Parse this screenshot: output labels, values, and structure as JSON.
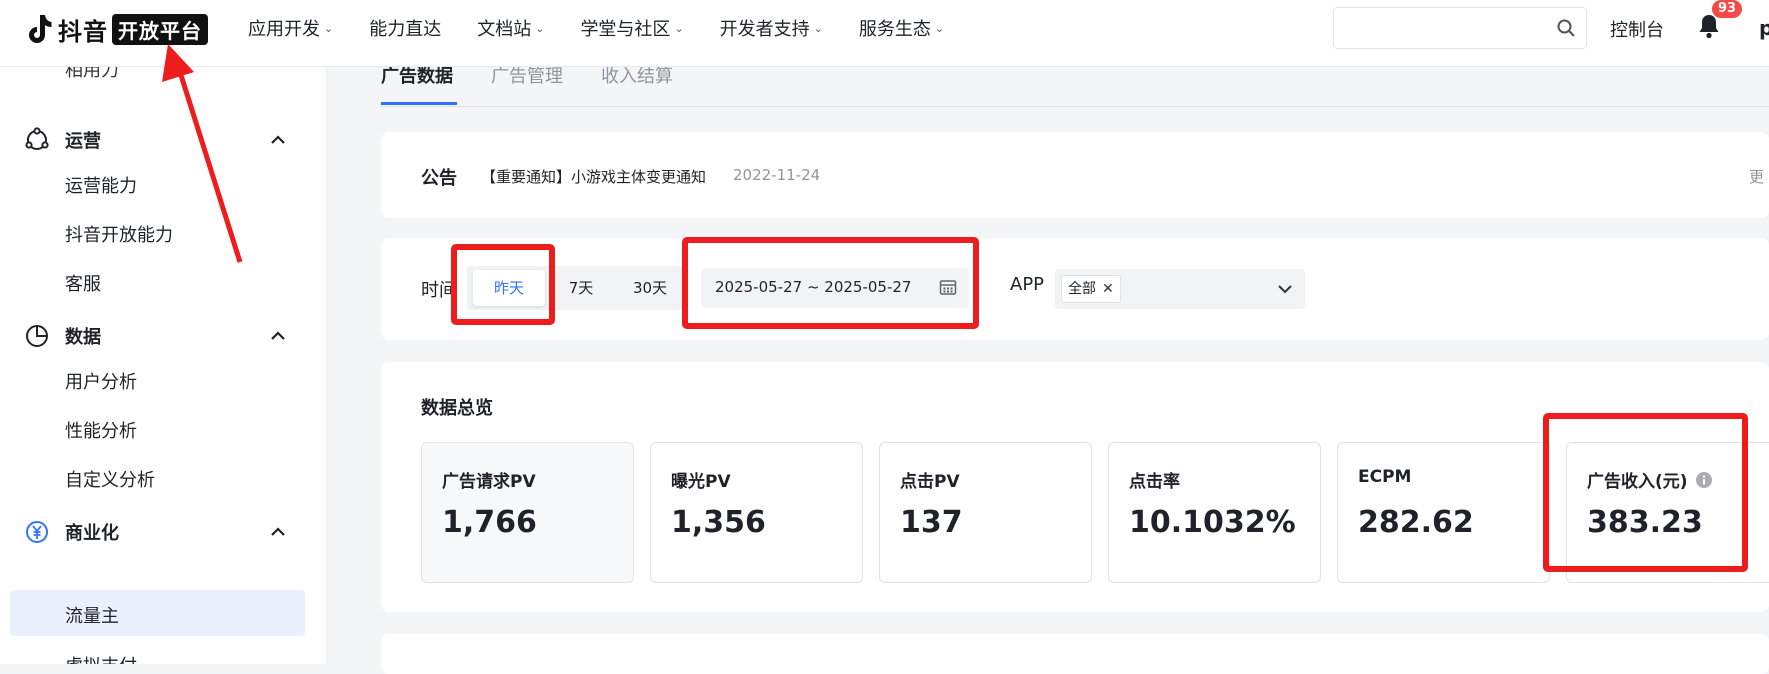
{
  "topnav": {
    "logo_text": "抖音",
    "logo_badge": "开放平台",
    "items": [
      {
        "label": "应用开发",
        "has_dropdown": true
      },
      {
        "label": "能力直达",
        "has_dropdown": false
      },
      {
        "label": "文档站",
        "has_dropdown": true
      },
      {
        "label": "学堂与社区",
        "has_dropdown": true
      },
      {
        "label": "开发者支持",
        "has_dropdown": true
      },
      {
        "label": "服务生态",
        "has_dropdown": true
      }
    ],
    "search": {
      "placeholder": "",
      "icon": "search-icon"
    },
    "console_label": "控制台",
    "notification_count": "93",
    "avatar_letter": "p"
  },
  "sidebar": {
    "partial_top_item": "相用力",
    "groups": [
      {
        "label": "运营",
        "icon": "operations-icon",
        "items": [
          "运营能力",
          "抖音开放能力",
          "客服"
        ]
      },
      {
        "label": "数据",
        "icon": "pie-chart-icon",
        "items": [
          "用户分析",
          "性能分析",
          "自定义分析"
        ]
      },
      {
        "label": "商业化",
        "icon": "yuan-icon",
        "items": [
          "流量主",
          "虚拟支付"
        ]
      }
    ],
    "active_item": "流量主"
  },
  "tabs": [
    {
      "label": "广告数据",
      "active": true
    },
    {
      "label": "广告管理",
      "active": false
    },
    {
      "label": "收入结算",
      "active": false
    }
  ],
  "notice": {
    "title": "公告",
    "text": "【重要通知】小游戏主体变更通知",
    "date": "2022-11-24",
    "more": "更"
  },
  "filters": {
    "time_label": "时间",
    "segments": [
      {
        "label": "昨天",
        "active": true
      },
      {
        "label": "7天",
        "active": false
      },
      {
        "label": "30天",
        "active": false
      }
    ],
    "date_range": "2025-05-27 ~ 2025-05-27",
    "app_label": "APP",
    "app_tag": "全部",
    "app_tag_close": "✕"
  },
  "overview": {
    "title": "数据总览",
    "metrics": [
      {
        "label": "广告请求PV",
        "value": "1,766"
      },
      {
        "label": "曝光PV",
        "value": "1,356"
      },
      {
        "label": "点击PV",
        "value": "137"
      },
      {
        "label": "点击率",
        "value": "10.1032%"
      },
      {
        "label": "ECPM",
        "value": "282.62"
      },
      {
        "label": "广告收入(元)",
        "value": "383.23",
        "has_info": true
      }
    ]
  },
  "colors": {
    "accent": "#3370ff",
    "annotation_red": "#ee1d1d",
    "badge_red": "#f54a45",
    "active_bg": "#ebf0fd",
    "page_bg": "#f4f5f7"
  }
}
